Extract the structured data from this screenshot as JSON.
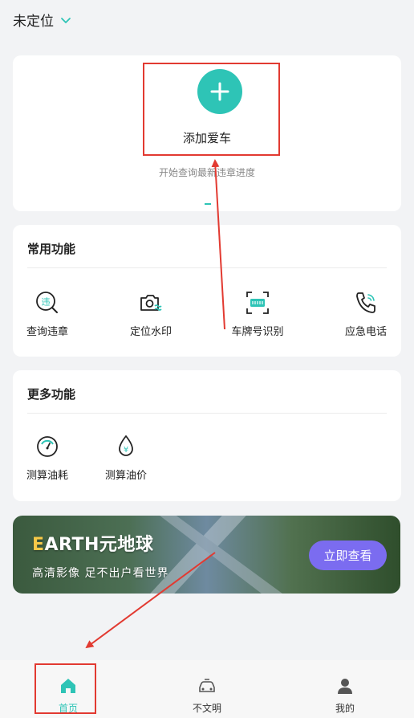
{
  "header": {
    "location": "未定位"
  },
  "add_card": {
    "title": "添加爱车",
    "subtitle": "开始查询最新违章进度"
  },
  "common": {
    "title": "常用功能",
    "items": [
      {
        "label": "查询违章",
        "icon": "violation-search-icon"
      },
      {
        "label": "定位水印",
        "icon": "camera-watermark-icon"
      },
      {
        "label": "车牌号识别",
        "icon": "plate-scan-icon"
      },
      {
        "label": "应急电话",
        "icon": "phone-icon"
      }
    ]
  },
  "more": {
    "title": "更多功能",
    "items": [
      {
        "label": "测算油耗",
        "icon": "gauge-icon"
      },
      {
        "label": "测算油价",
        "icon": "fuel-drop-icon"
      }
    ]
  },
  "banner": {
    "brand_first": "E",
    "brand_rest": "ARTH元地球",
    "subtitle": "高清影像 足不出户看世界",
    "button": "立即查看"
  },
  "tabs": [
    {
      "label": "首页",
      "icon": "home-icon",
      "active": true
    },
    {
      "label": "不文明",
      "icon": "car-icon",
      "active": false
    },
    {
      "label": "我的",
      "icon": "user-icon",
      "active": false
    }
  ],
  "colors": {
    "accent": "#2ec4b6",
    "highlight": "#e23a31",
    "banner_button": "#7b6cf0"
  }
}
